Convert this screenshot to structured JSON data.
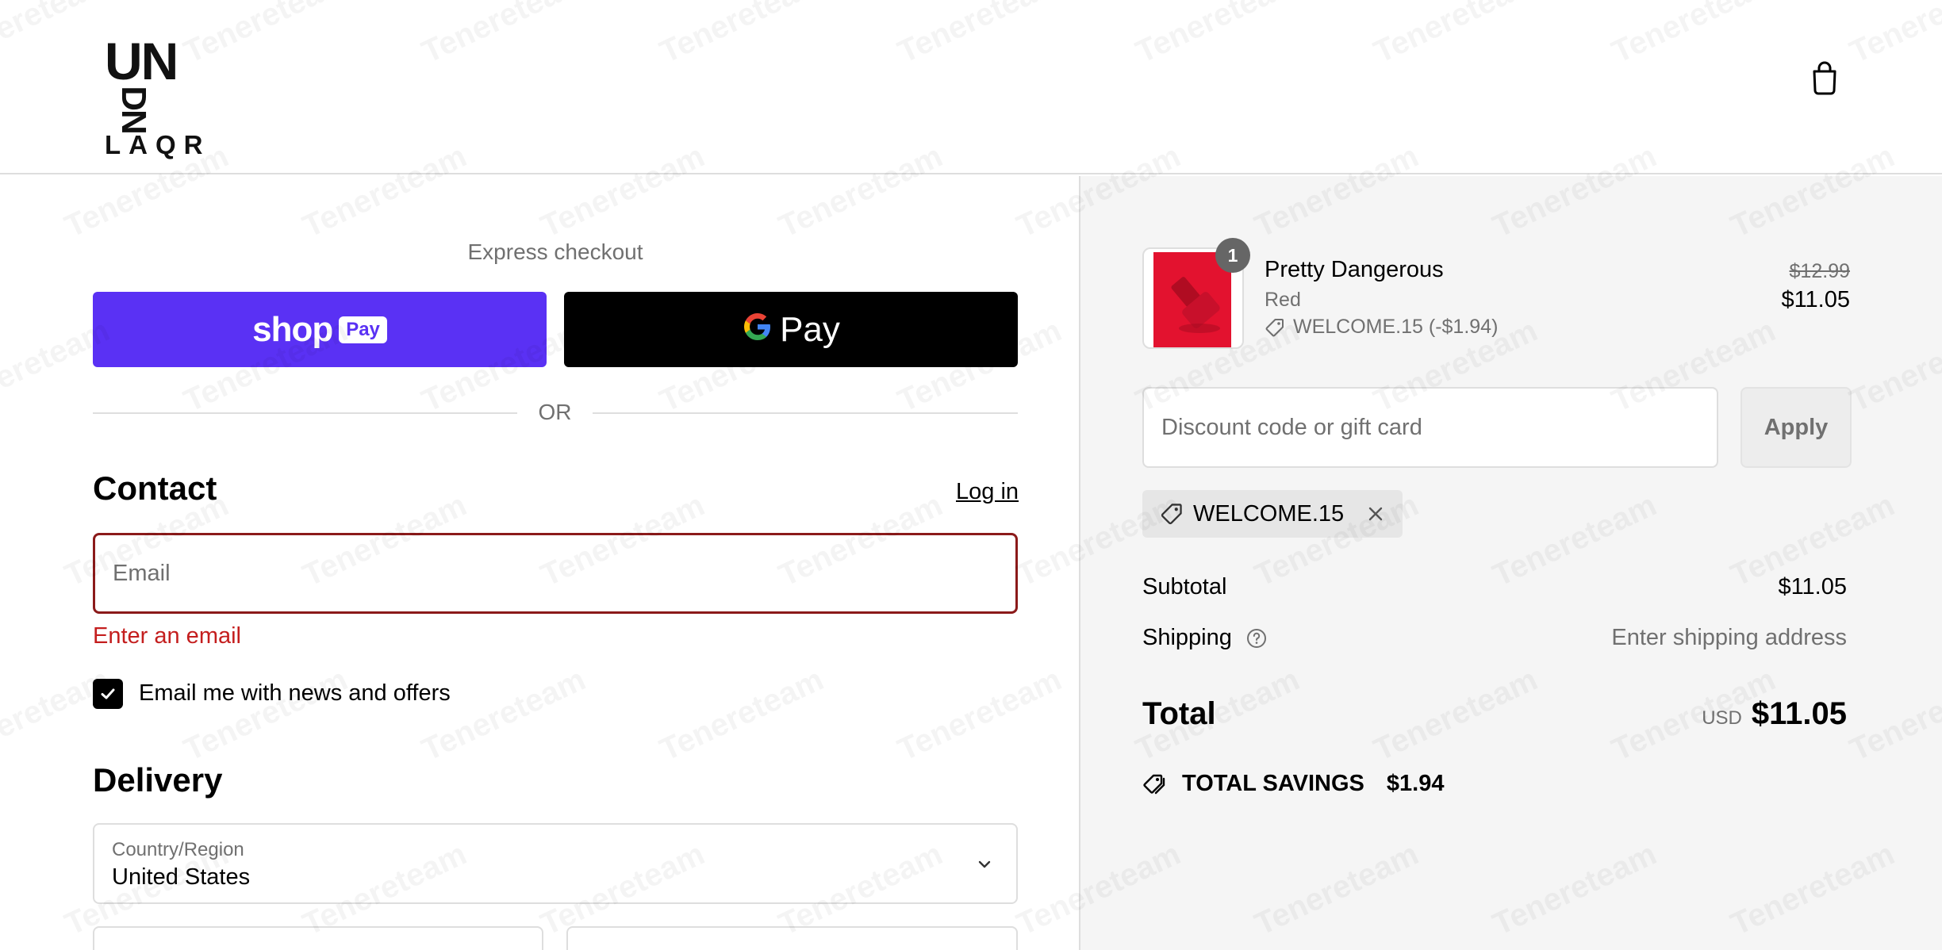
{
  "brand": {
    "logo_top": "UN",
    "logo_rot": "DN",
    "logo_bottom": "LAQR"
  },
  "header": {
    "cart_icon": "shopping-bag-icon"
  },
  "express": {
    "title": "Express checkout",
    "shop_pay_word": "shop",
    "shop_pay_badge": "Pay",
    "gpay_g": "G",
    "gpay_label": "Pay"
  },
  "divider": {
    "or": "OR"
  },
  "contact": {
    "title": "Contact",
    "login": "Log in",
    "email_placeholder": "Email",
    "email_value": "",
    "error": "Enter an email",
    "newsletter_label": "Email me with news and offers",
    "newsletter_checked": true
  },
  "delivery": {
    "title": "Delivery",
    "country_label": "Country/Region",
    "country_value": "United States"
  },
  "summary": {
    "product": {
      "name": "Pretty Dangerous",
      "variant": "Red",
      "discount_line": "WELCOME.15 (-$1.94)",
      "quantity": "1",
      "price_original": "$12.99",
      "price_final": "$11.05"
    },
    "discount_placeholder": "Discount code or gift card",
    "apply_label": "Apply",
    "applied_code": "WELCOME.15",
    "subtotal_label": "Subtotal",
    "subtotal_value": "$11.05",
    "shipping_label": "Shipping",
    "shipping_value": "Enter shipping address",
    "total_label": "Total",
    "total_currency": "USD",
    "total_value": "$11.05",
    "savings_label": "TOTAL SAVINGS",
    "savings_value": "$1.94"
  },
  "colors": {
    "shop_pay": "#5a31f4",
    "gpay": "#000000",
    "error": "#c41e1e",
    "error_border": "#8b1a1a",
    "product_red": "#e3122f",
    "sidebar_bg": "#f5f5f5"
  },
  "watermark": {
    "text": "Tenereteam"
  }
}
